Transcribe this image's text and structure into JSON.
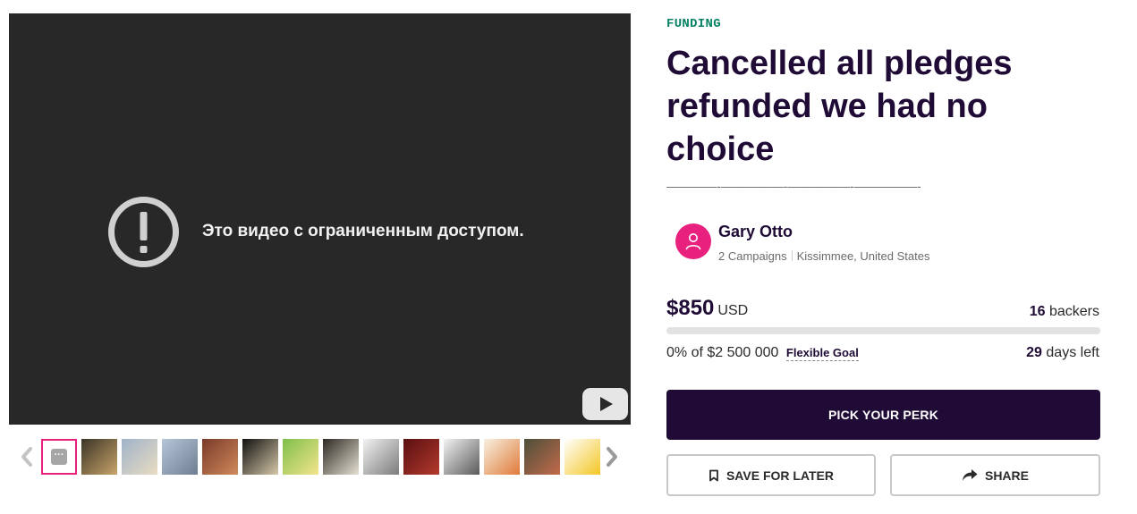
{
  "video": {
    "message": "Это видео с ограниченным доступом.",
    "icons": [
      "warning-icon",
      "youtube-logo-icon"
    ]
  },
  "gallery": {
    "prev_icon": "chevron-left-icon",
    "next_icon": "chevron-right-icon",
    "active_thumb_glyph": "···",
    "thumbs": [
      {
        "colors": [
          "#ffffff",
          "#ffffff"
        ]
      },
      {
        "colors": [
          "#3a3426",
          "#c9a46a"
        ]
      },
      {
        "colors": [
          "#9fb3c9",
          "#e9dcc2"
        ]
      },
      {
        "colors": [
          "#b6c6d8",
          "#6f7d92"
        ]
      },
      {
        "colors": [
          "#7a3a2a",
          "#d08a5a"
        ]
      },
      {
        "colors": [
          "#111111",
          "#d6c7a8"
        ]
      },
      {
        "colors": [
          "#7fbf4a",
          "#f4e58a"
        ]
      },
      {
        "colors": [
          "#2e2a24",
          "#e5e0d2"
        ]
      },
      {
        "colors": [
          "#f2f2f2",
          "#7b7b7b"
        ]
      },
      {
        "colors": [
          "#5a0f12",
          "#b23a2c"
        ]
      },
      {
        "colors": [
          "#f3f3f3",
          "#5a5a5a"
        ]
      },
      {
        "colors": [
          "#f8f1e0",
          "#e07a3a"
        ]
      },
      {
        "colors": [
          "#4b4f3a",
          "#c46a4a"
        ]
      },
      {
        "colors": [
          "#ffffff",
          "#f3c623"
        ]
      }
    ]
  },
  "campaign": {
    "tag": "FUNDING",
    "title": "Cancelled all pledges refunded we had no choice",
    "tagline": "————-—————-—————-—————-"
  },
  "owner": {
    "name": "Gary Otto",
    "campaigns": "2 Campaigns",
    "location": "Kissimmee, United States",
    "avatar_icon": "user-icon"
  },
  "funding": {
    "amount": "$850",
    "currency": "USD",
    "backers_count": "16",
    "backers_label": "backers",
    "percent_text": "0% of $2 500 000",
    "progress_fraction": 0.0,
    "goal_type": "Flexible Goal",
    "days_count": "29",
    "days_label": "days left"
  },
  "actions": {
    "pick_perk": "PICK YOUR PERK",
    "save_for_later": "SAVE FOR LATER",
    "share": "SHARE"
  },
  "colors": {
    "brand_pink": "#e8217f",
    "navy": "#1f0b35",
    "tag_green": "#088366"
  }
}
